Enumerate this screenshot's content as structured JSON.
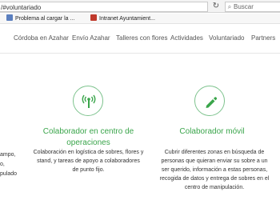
{
  "browser": {
    "url": "/#voluntariado",
    "search_placeholder": "Buscar",
    "bookmarks": [
      {
        "label": "Problema al cargar la ..."
      },
      {
        "label": "Intranet Ayuntamient..."
      }
    ]
  },
  "nav": {
    "items": [
      {
        "label": "Córdoba en Azahar"
      },
      {
        "label": "Envío Azahar"
      },
      {
        "label": "Talleres con flores"
      },
      {
        "label": "Actividades"
      },
      {
        "label": "Voluntariado"
      },
      {
        "label": "Partners"
      }
    ]
  },
  "content": {
    "left": {
      "title_line1": "Colaborador en centro de",
      "title_line2": "operaciones",
      "desc_line1": "Colaboración en logística de sobres, flores y",
      "desc_line2": "stand, y tareas de apoyo a colaboradores",
      "desc_line3": "de punto fijo."
    },
    "right": {
      "title": "Colaborador móvil",
      "desc_line1": "Cubrir diferentes zonas en búsqueda de",
      "desc_line2": "personas que quieran enviar su sobre a un",
      "desc_line3": "ser querido, información a estas personas,",
      "desc_line4": "recogida de datos y entrega de sobres en el",
      "desc_line5": "centro de manipulación."
    },
    "partial_left": {
      "line1": "ampo,",
      "line2": "o,",
      "line3": "pulado"
    }
  },
  "colors": {
    "accent_green": "#3aa54b",
    "circle_border": "#7ec38e"
  },
  "icons": {
    "left": "antenna-icon",
    "right": "pen-icon"
  }
}
